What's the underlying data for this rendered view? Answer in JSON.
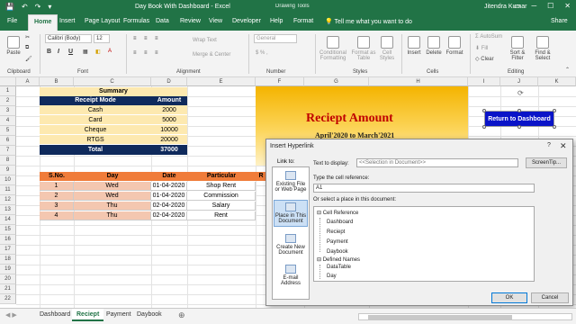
{
  "window": {
    "title": "Day Book With Dashboard  -  Excel",
    "context_tools": "Drawing Tools",
    "user": "Jitendra Kumar",
    "quick_access": [
      "💾",
      "↶",
      "↷",
      "▾"
    ],
    "window_buttons": [
      "▭",
      "─",
      "☐",
      "✕"
    ]
  },
  "ribbon_tabs": [
    "File",
    "Home",
    "Insert",
    "Page Layout",
    "Formulas",
    "Data",
    "Review",
    "View",
    "Developer",
    "Help",
    "Format"
  ],
  "active_tab": "Home",
  "tell_me": "Tell me what you want to do",
  "share": "Share",
  "ribbon": {
    "clipboard": {
      "paste": "Paste",
      "label": "Clipboard"
    },
    "font": {
      "family": "Calibri (Body)",
      "size": "12",
      "bold": "B",
      "italic": "I",
      "underline": "U",
      "label": "Font"
    },
    "alignment": {
      "wrap": "Wrap Text",
      "merge": "Merge & Center",
      "label": "Alignment"
    },
    "number": {
      "format": "General",
      "label": "Number"
    },
    "styles": {
      "conditional": "Conditional Formatting",
      "format_table": "Format as Table",
      "cell_styles": "Cell Styles",
      "label": "Styles"
    },
    "cells": {
      "insert": "Insert",
      "delete": "Delete",
      "format": "Format",
      "label": "Cells"
    },
    "editing": {
      "autosum": "AutoSum",
      "fill": "Fill",
      "clear": "Clear",
      "sort": "Sort & Filter",
      "find": "Find & Select",
      "label": "Editing"
    }
  },
  "columns": [
    "A",
    "B",
    "C",
    "D",
    "E",
    "F",
    "G",
    "H",
    "I",
    "J",
    "K"
  ],
  "rows": [
    "1",
    "2",
    "3",
    "4",
    "5",
    "6",
    "7",
    "8",
    "9",
    "10",
    "11",
    "12",
    "13",
    "14",
    "15",
    "16",
    "17",
    "18",
    "19",
    "20",
    "21",
    "22"
  ],
  "summary": {
    "title": "Summary",
    "headers": [
      "Receipt Mode",
      "Amount"
    ],
    "rows": [
      {
        "mode": "Cash",
        "amount": "2000"
      },
      {
        "mode": "Card",
        "amount": "5000"
      },
      {
        "mode": "Cheque",
        "amount": "10000"
      },
      {
        "mode": "RTGS",
        "amount": "20000"
      }
    ],
    "total_label": "Total",
    "total_value": "37000"
  },
  "banner": {
    "title": "Reciept Amount",
    "subtitle": "April'2020 to March'2021"
  },
  "return_button": "Return to Dashboard",
  "daybook": {
    "headers": [
      "S.No.",
      "Day",
      "Date",
      "Particular",
      "R"
    ],
    "rows": [
      {
        "sno": "1",
        "day": "Wed",
        "date": "01-04-2020",
        "particular": "Shop Rent"
      },
      {
        "sno": "2",
        "day": "Wed",
        "date": "01-04-2020",
        "particular": "Commission"
      },
      {
        "sno": "3",
        "day": "Thu",
        "date": "02-04-2020",
        "particular": "Salary"
      },
      {
        "sno": "4",
        "day": "Thu",
        "date": "02-04-2020",
        "particular": "Rent"
      }
    ]
  },
  "dialog": {
    "title": "Insert Hyperlink",
    "help": "?",
    "close": "✕",
    "link_to_label": "Link to:",
    "link_options": [
      "Existing File or Web Page",
      "Place in This Document",
      "Create New Document",
      "E-mail Address"
    ],
    "selected_link": "Place in This Document",
    "text_to_display_label": "Text to display:",
    "text_to_display_value": "<<Selection in Document>>",
    "screentip": "ScreenTip...",
    "cell_ref_label": "Type the cell reference:",
    "cell_ref_value": "A1",
    "place_label": "Or select a place in this document:",
    "tree": {
      "cell_reference": "Cell Reference",
      "sheets": [
        "Dashboard",
        "Reciept",
        "Payment",
        "Daybook"
      ],
      "defined_names": "Defined Names",
      "names": [
        "DataTable",
        "Day"
      ]
    },
    "ok": "OK",
    "cancel": "Cancel"
  },
  "sheet_tabs": [
    "Dashboard",
    "Reciept",
    "Payment",
    "Daybook"
  ],
  "active_sheet": "Reciept"
}
